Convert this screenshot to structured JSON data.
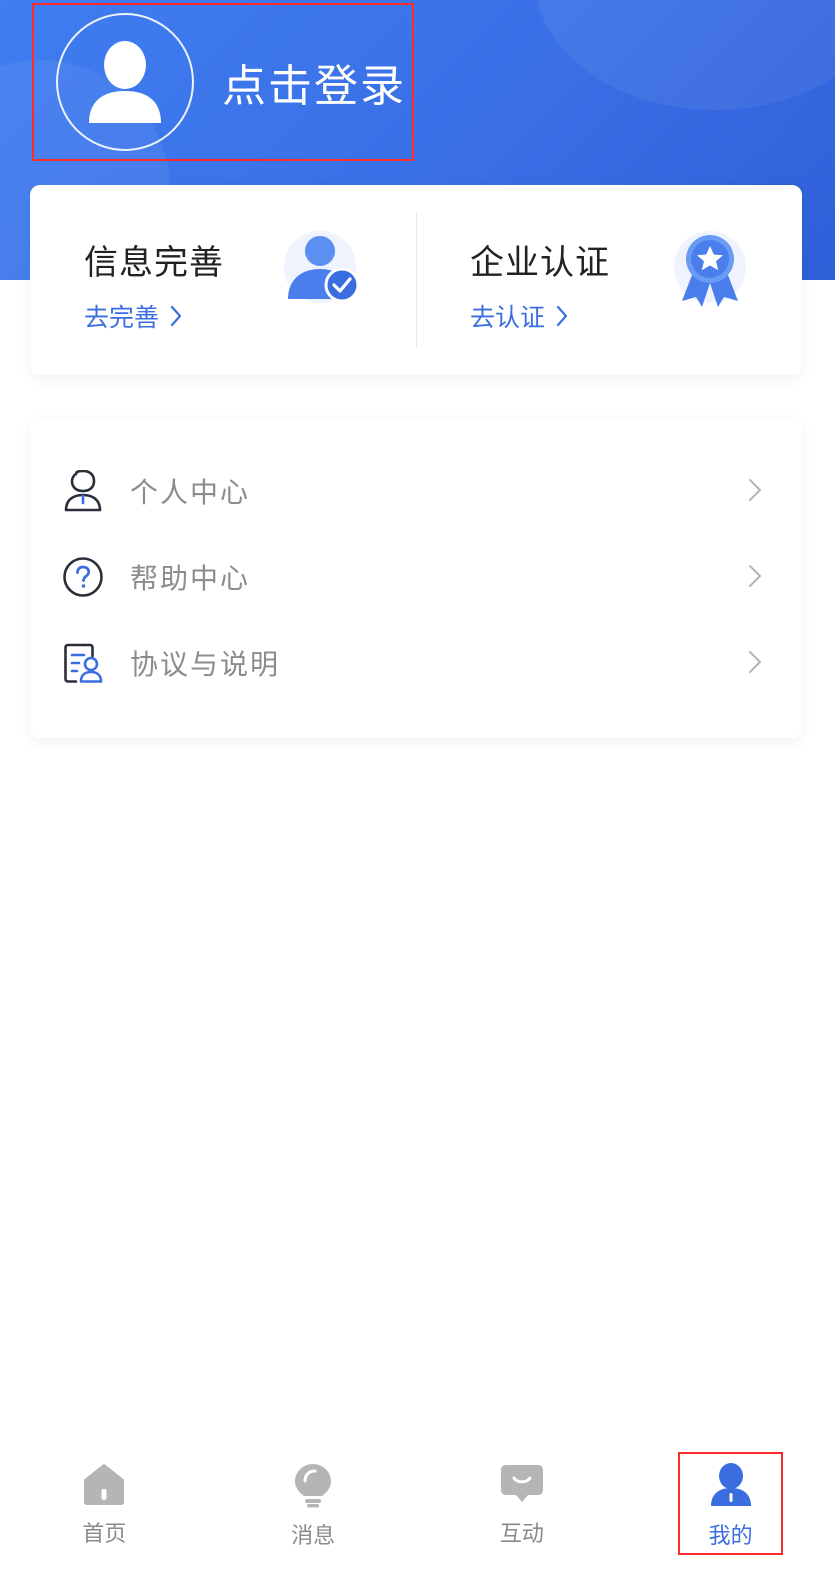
{
  "header": {
    "login_label": "点击登录",
    "accent_color": "#3a6fe6",
    "highlight_color": "#ff2a2a"
  },
  "top_card": {
    "info": {
      "title": "信息完善",
      "link": "去完善",
      "icon": "user-check-icon"
    },
    "enterprise": {
      "title": "企业认证",
      "link": "去认证",
      "icon": "medal-star-icon"
    }
  },
  "menu": {
    "items": [
      {
        "label": "个人中心",
        "icon": "person-icon"
      },
      {
        "label": "帮助中心",
        "icon": "question-circle-icon"
      },
      {
        "label": "协议与说明",
        "icon": "document-user-icon"
      }
    ]
  },
  "tabbar": {
    "items": [
      {
        "label": "首页",
        "icon": "home-icon",
        "active": false
      },
      {
        "label": "消息",
        "icon": "lightbulb-icon",
        "active": false
      },
      {
        "label": "互动",
        "icon": "chat-icon",
        "active": false
      },
      {
        "label": "我的",
        "icon": "user-icon",
        "active": true
      }
    ]
  }
}
